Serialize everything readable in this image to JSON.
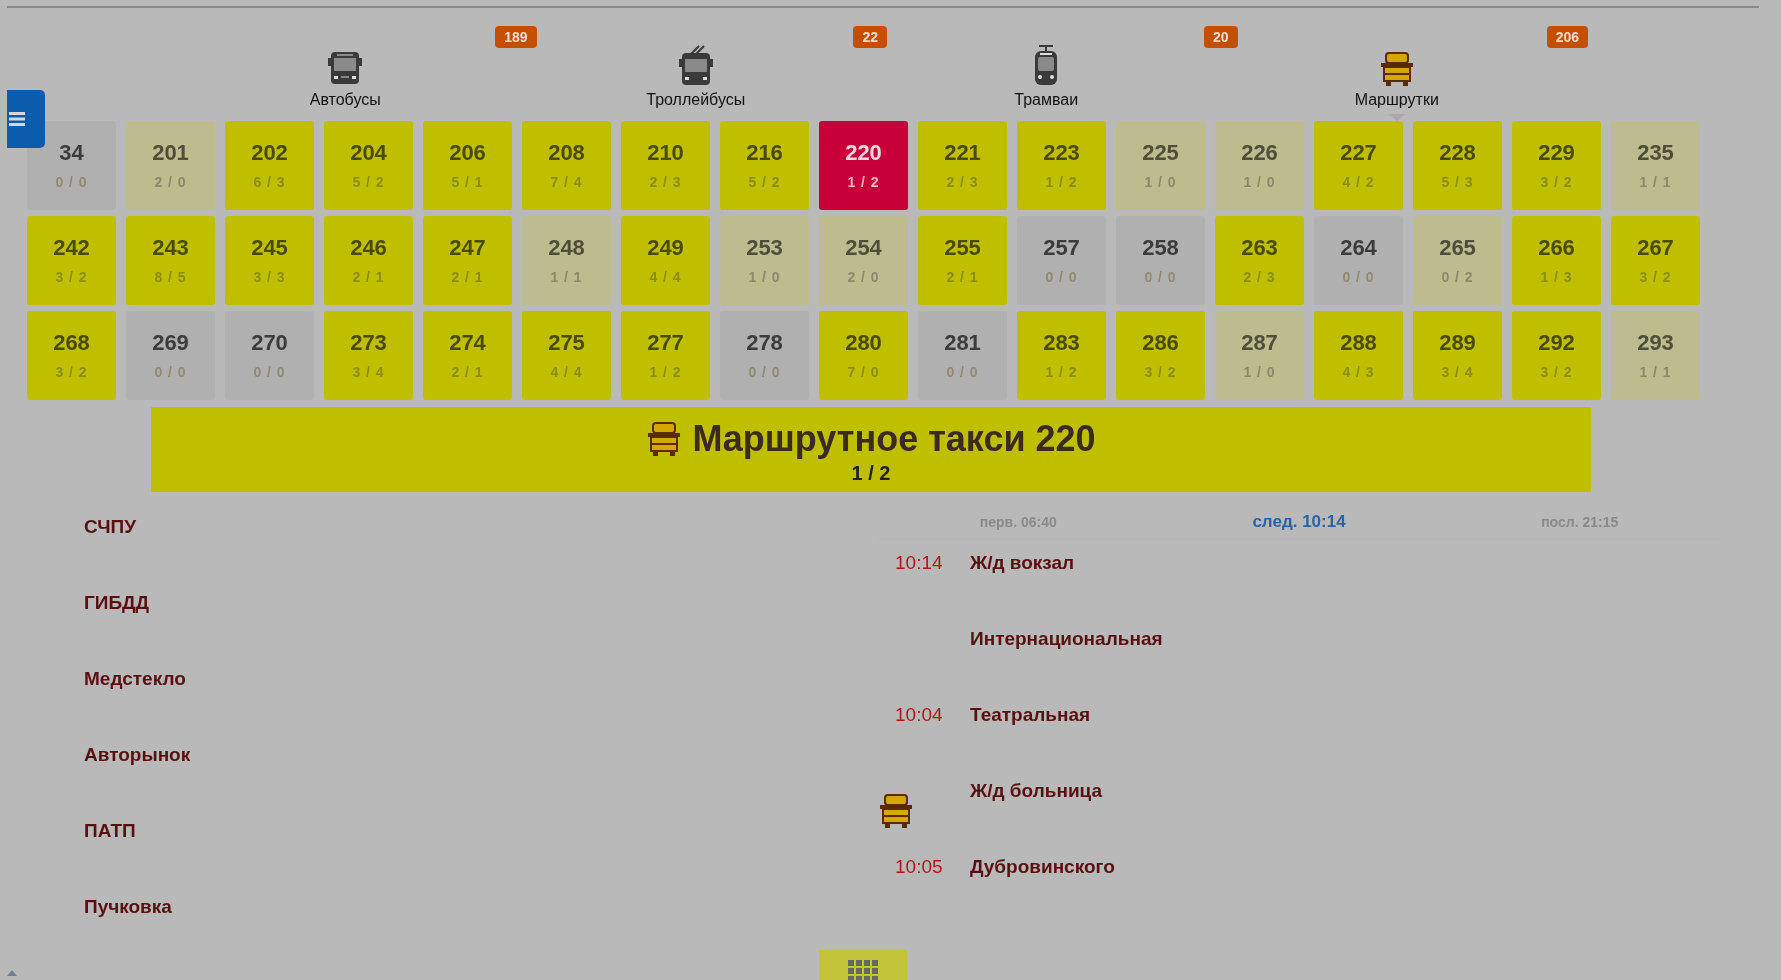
{
  "transport_tabs": [
    {
      "label": "Автобусы",
      "count": "189",
      "kind": "bus",
      "selected": false
    },
    {
      "label": "Троллейбусы",
      "count": "22",
      "kind": "trolleybus",
      "selected": false
    },
    {
      "label": "Трамваи",
      "count": "20",
      "kind": "tram",
      "selected": false
    },
    {
      "label": "Маршрутки",
      "count": "206",
      "kind": "minibus",
      "selected": true
    }
  ],
  "routes": [
    {
      "number": "34",
      "counts": "0 / 0",
      "kind": "idle",
      "selected": false
    },
    {
      "number": "201",
      "counts": "2 / 0",
      "kind": "few",
      "selected": false
    },
    {
      "number": "202",
      "counts": "6 / 3",
      "kind": "active",
      "selected": false
    },
    {
      "number": "204",
      "counts": "5 / 2",
      "kind": "active",
      "selected": false
    },
    {
      "number": "206",
      "counts": "5 / 1",
      "kind": "active",
      "selected": false
    },
    {
      "number": "208",
      "counts": "7 / 4",
      "kind": "active",
      "selected": false
    },
    {
      "number": "210",
      "counts": "2 / 3",
      "kind": "active",
      "selected": false
    },
    {
      "number": "216",
      "counts": "5 / 2",
      "kind": "active",
      "selected": false
    },
    {
      "number": "220",
      "counts": "1 / 2",
      "kind": "active",
      "selected": true
    },
    {
      "number": "221",
      "counts": "2 / 3",
      "kind": "active",
      "selected": false
    },
    {
      "number": "223",
      "counts": "1 / 2",
      "kind": "active",
      "selected": false
    },
    {
      "number": "225",
      "counts": "1 / 0",
      "kind": "few",
      "selected": false
    },
    {
      "number": "226",
      "counts": "1 / 0",
      "kind": "few",
      "selected": false
    },
    {
      "number": "227",
      "counts": "4 / 2",
      "kind": "active",
      "selected": false
    },
    {
      "number": "228",
      "counts": "5 / 3",
      "kind": "active",
      "selected": false
    },
    {
      "number": "229",
      "counts": "3 / 2",
      "kind": "active",
      "selected": false
    },
    {
      "number": "235",
      "counts": "1 / 1",
      "kind": "few",
      "selected": false
    },
    {
      "number": "242",
      "counts": "3 / 2",
      "kind": "active",
      "selected": false
    },
    {
      "number": "243",
      "counts": "8 / 5",
      "kind": "active",
      "selected": false
    },
    {
      "number": "245",
      "counts": "3 / 3",
      "kind": "active",
      "selected": false
    },
    {
      "number": "246",
      "counts": "2 / 1",
      "kind": "active",
      "selected": false
    },
    {
      "number": "247",
      "counts": "2 / 1",
      "kind": "active",
      "selected": false
    },
    {
      "number": "248",
      "counts": "1 / 1",
      "kind": "few",
      "selected": false
    },
    {
      "number": "249",
      "counts": "4 / 4",
      "kind": "active",
      "selected": false
    },
    {
      "number": "253",
      "counts": "1 / 0",
      "kind": "few",
      "selected": false
    },
    {
      "number": "254",
      "counts": "2 / 0",
      "kind": "few",
      "selected": false
    },
    {
      "number": "255",
      "counts": "2 / 1",
      "kind": "active",
      "selected": false
    },
    {
      "number": "257",
      "counts": "0 / 0",
      "kind": "idle",
      "selected": false
    },
    {
      "number": "258",
      "counts": "0 / 0",
      "kind": "idle",
      "selected": false
    },
    {
      "number": "263",
      "counts": "2 / 3",
      "kind": "active",
      "selected": false
    },
    {
      "number": "264",
      "counts": "0 / 0",
      "kind": "idle",
      "selected": false
    },
    {
      "number": "265",
      "counts": "0 / 2",
      "kind": "few",
      "selected": false
    },
    {
      "number": "266",
      "counts": "1 / 3",
      "kind": "active",
      "selected": false
    },
    {
      "number": "267",
      "counts": "3 / 2",
      "kind": "active",
      "selected": false
    },
    {
      "number": "268",
      "counts": "3 / 2",
      "kind": "active",
      "selected": false
    },
    {
      "number": "269",
      "counts": "0 / 0",
      "kind": "idle",
      "selected": false
    },
    {
      "number": "270",
      "counts": "0 / 0",
      "kind": "idle",
      "selected": false
    },
    {
      "number": "273",
      "counts": "3 / 4",
      "kind": "active",
      "selected": false
    },
    {
      "number": "274",
      "counts": "2 / 1",
      "kind": "active",
      "selected": false
    },
    {
      "number": "275",
      "counts": "4 / 4",
      "kind": "active",
      "selected": false
    },
    {
      "number": "277",
      "counts": "1 / 2",
      "kind": "active",
      "selected": false
    },
    {
      "number": "278",
      "counts": "0 / 0",
      "kind": "idle",
      "selected": false
    },
    {
      "number": "280",
      "counts": "7 / 0",
      "kind": "active",
      "selected": false
    },
    {
      "number": "281",
      "counts": "0 / 0",
      "kind": "idle",
      "selected": false
    },
    {
      "number": "283",
      "counts": "1 / 2",
      "kind": "active",
      "selected": false
    },
    {
      "number": "286",
      "counts": "3 / 2",
      "kind": "active",
      "selected": false
    },
    {
      "number": "287",
      "counts": "1 / 0",
      "kind": "few",
      "selected": false
    },
    {
      "number": "288",
      "counts": "4 / 3",
      "kind": "active",
      "selected": false
    },
    {
      "number": "289",
      "counts": "3 / 4",
      "kind": "active",
      "selected": false
    },
    {
      "number": "292",
      "counts": "3 / 2",
      "kind": "active",
      "selected": false
    },
    {
      "number": "293",
      "counts": "1 / 1",
      "kind": "few",
      "selected": false
    }
  ],
  "route_banner": {
    "kind": "minibus",
    "title": "Маршрутное такси 220",
    "counts": "1 / 2"
  },
  "stops": [
    "СЧПУ",
    "ГИБДД",
    "Медстекло",
    "Авторынок",
    "ПАТП",
    "Пучковка"
  ],
  "schedule": {
    "first": "перв. 06:40",
    "next": "след. 10:14",
    "last": "посл. 21:15",
    "stops": [
      {
        "time": "10:14",
        "name": "Ж/д вокзал",
        "vehicle": false
      },
      {
        "name": "Интернациональная",
        "vehicle": false
      },
      {
        "time": "10:04",
        "name": "Театральная",
        "vehicle": false
      },
      {
        "name": "Ж/д больница",
        "vehicle": true
      },
      {
        "time": "10:05",
        "name": "Дубровинского",
        "vehicle": false
      }
    ]
  }
}
